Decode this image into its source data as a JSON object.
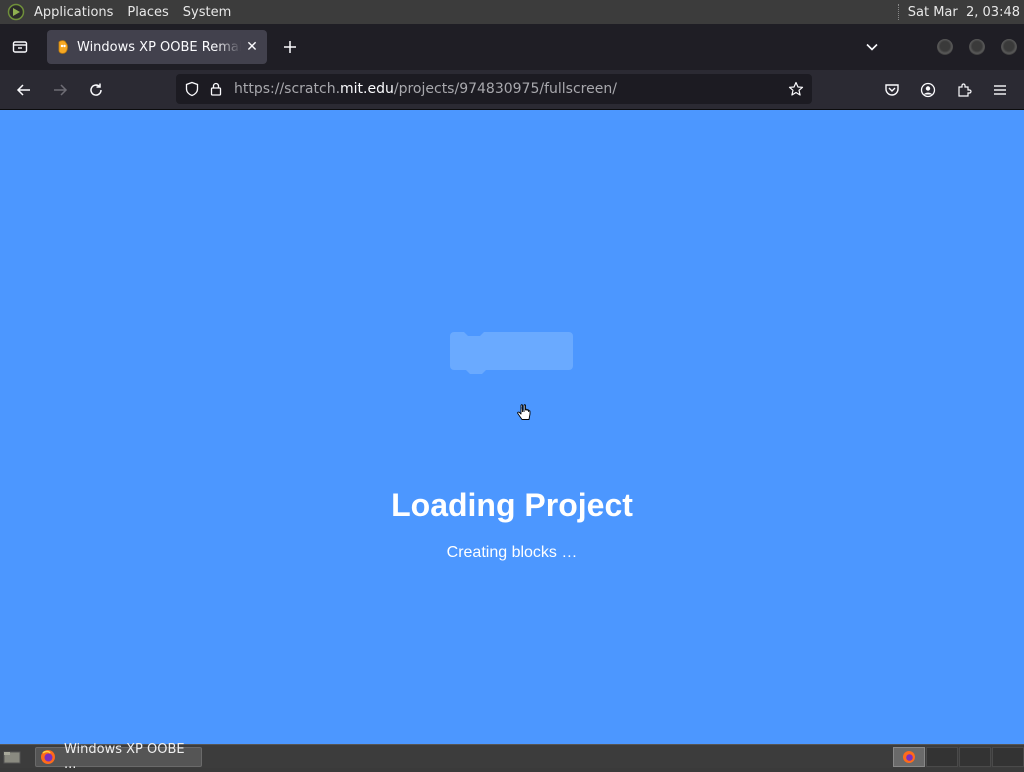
{
  "top_panel": {
    "menus": [
      "Applications",
      "Places",
      "System"
    ],
    "clock": "Sat Mar  2, 03:48"
  },
  "browser": {
    "tab": {
      "title": "Windows XP OOBE Remake",
      "close_icon": "close-icon"
    },
    "url": {
      "prefix": "https://scratch.",
      "host": "mit.edu",
      "path": "/projects/974830975/fullscreen/"
    },
    "icons": {
      "back": "back-arrow-icon",
      "forward": "forward-arrow-icon",
      "reload": "reload-icon",
      "shield": "shield-icon",
      "lock": "lock-icon",
      "bookmark": "star-icon",
      "pocket": "pocket-icon",
      "account": "account-icon",
      "extensions": "extensions-icon",
      "menu": "hamburger-menu-icon"
    }
  },
  "page": {
    "title": "Loading Project",
    "message": "Creating blocks …",
    "background": "#4c97ff"
  },
  "taskbar": {
    "window_button": "Windows XP OOBE ..."
  }
}
